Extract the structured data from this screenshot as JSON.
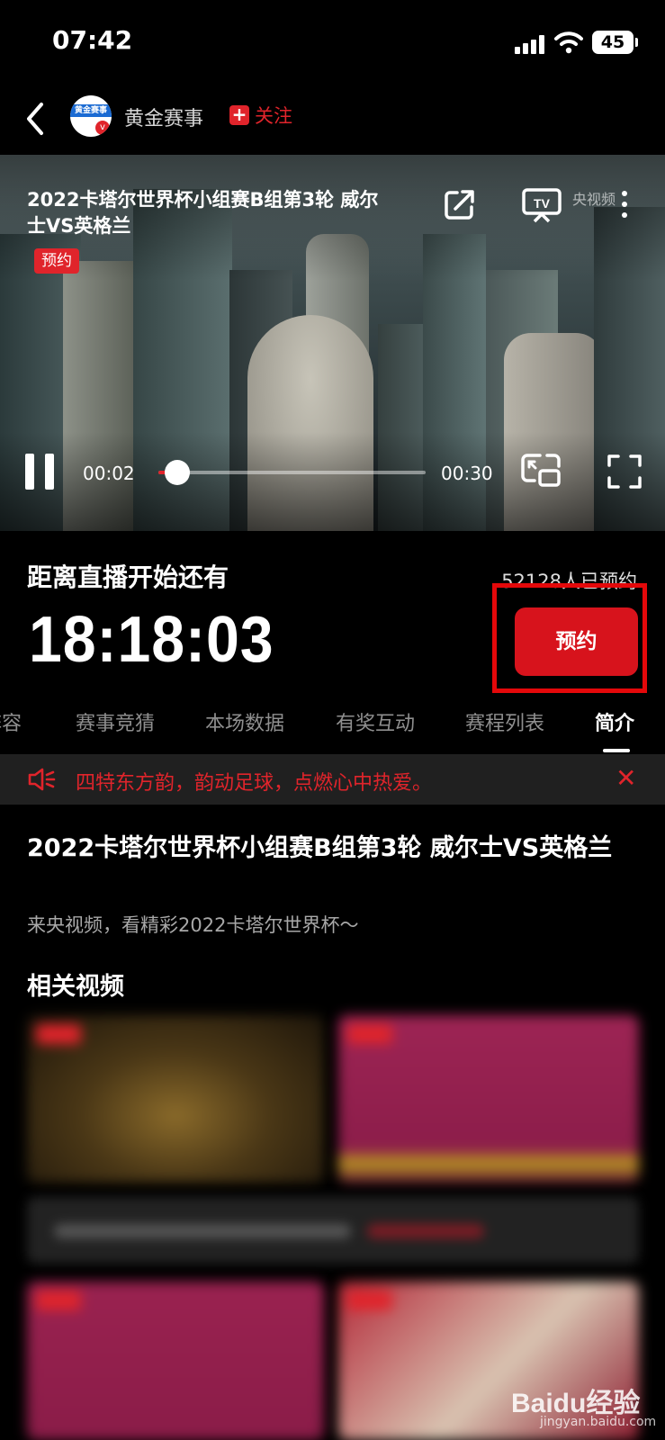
{
  "status_bar": {
    "time": "07:42",
    "battery": "45"
  },
  "header": {
    "channel_name": "黄金赛事",
    "follow_label": "关注",
    "avatar_text": "黄金赛事"
  },
  "video": {
    "title": "2022卡塔尔世界杯小组赛B组第3轮 威尔士VS英格兰",
    "tag": "预约",
    "watermark": "央视频",
    "current_time": "00:02",
    "duration": "00:30",
    "progress_fraction": 0.07
  },
  "countdown": {
    "label": "距离直播开始还有",
    "reserve_count": "52128人已预约",
    "timer": "18:18:03",
    "reserve_button": "预约"
  },
  "tabs": [
    {
      "label": "阵容"
    },
    {
      "label": "赛事竞猜"
    },
    {
      "label": "本场数据"
    },
    {
      "label": "有奖互动"
    },
    {
      "label": "赛程列表"
    },
    {
      "label": "简介",
      "active": true
    }
  ],
  "notice": {
    "text": "四特东方韵，韵动足球，点燃心中热爱。"
  },
  "intro": {
    "title": "2022卡塔尔世界杯小组赛B组第3轮 威尔士VS英格兰",
    "description": "来央视频，看精彩2022卡塔尔世界杯～"
  },
  "related": {
    "heading": "相关视频"
  },
  "watermark": {
    "brand": "Baidu经验",
    "url": "jingyan.baidu.com"
  },
  "colors": {
    "accent": "#e0242b",
    "background": "#000000",
    "highlight_frame": "#e4080a"
  }
}
